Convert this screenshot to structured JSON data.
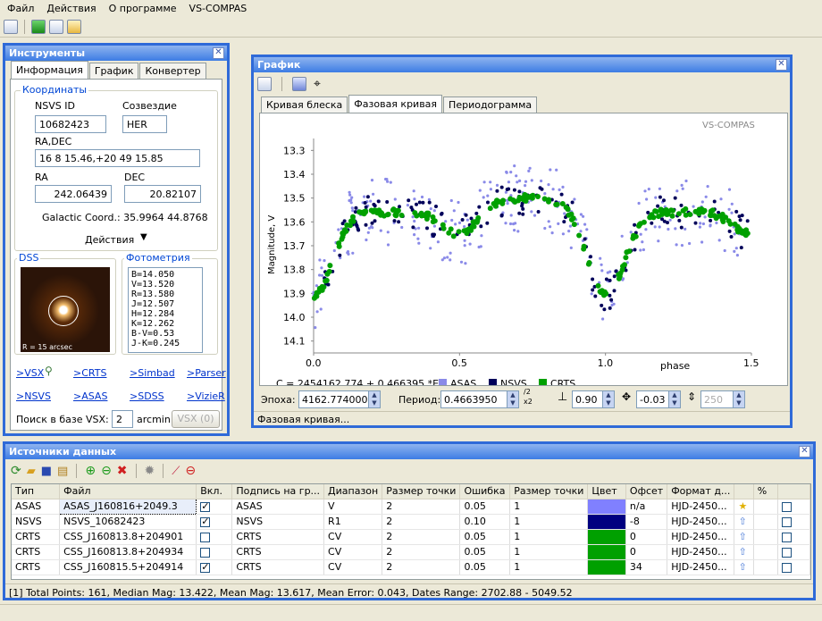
{
  "menu": [
    "Файл",
    "Действия",
    "О программе",
    "VS-COMPAS"
  ],
  "tools": {
    "title": "Инструменты",
    "tabs": [
      "Информация",
      "График",
      "Конвертер"
    ],
    "coords": {
      "group_label": "Координаты",
      "nsvs_label": "NSVS ID",
      "nsvs_value": "10682423",
      "const_label": "Созвездие",
      "const_value": "HER",
      "radec_label": "RA,DEC",
      "radec_value": "16 8 15.46,+20 49 15.85",
      "ra_label": "RA",
      "ra_value": "242.06439",
      "dec_label": "DEC",
      "dec_value": "20.82107",
      "galactic": "Galactic Coord.: 35.9964 44.8768",
      "actions": "Действия"
    },
    "dss": {
      "label": "DSS",
      "radius": "R = 15 arcsec"
    },
    "photometry": {
      "label": "Фотометрия",
      "lines": [
        "B=14.050",
        "V=13.520",
        "R=13.580",
        "J=12.507",
        "H=12.284",
        "K=12.262",
        "B-V=0.53",
        "J-K=0.245"
      ]
    },
    "links": [
      ">VSX",
      ">CRTS",
      ">Simbad",
      ">Parser",
      ">NSVS",
      ">ASAS",
      ">SDSS",
      ">VizieR"
    ],
    "search_label": "Поиск в базе VSX:",
    "search_value": "2",
    "search_unit": "arcmin",
    "vsx_button": "VSX (0)"
  },
  "graph": {
    "title": "График",
    "tabs": [
      "Кривая блеска",
      "Фазовая кривая",
      "Периодограмма"
    ],
    "watermark": "VS-COMPAS",
    "epoch_label": "Эпоха:",
    "epoch_value": "4162.774000",
    "period_label": "Период:",
    "period_value": "0.4663950",
    "period_mult": "/2",
    "period_mult2": "x2",
    "spin1": "0.90",
    "spin2": "-0.03",
    "spin3": "250",
    "status": "Фазовая кривая..."
  },
  "chart_data": {
    "type": "scatter",
    "xlabel": "phase",
    "ylabel": "Magnitude, V",
    "xlim": [
      0,
      1.5
    ],
    "ylim": [
      14.15,
      13.25
    ],
    "xticks": [
      "0.0",
      "0.5",
      "1.0",
      "1.5"
    ],
    "yticks": [
      "13.3",
      "13.4",
      "13.5",
      "13.6",
      "13.7",
      "13.8",
      "13.9",
      "14.0",
      "14.1"
    ],
    "formula": "C = 2454162.774 + 0.466395 *E",
    "legend": [
      {
        "name": "ASAS",
        "color": "#8a8ae8"
      },
      {
        "name": "NSVS",
        "color": "#00005a"
      },
      {
        "name": "CRTS",
        "color": "#00a000"
      }
    ],
    "series": [
      {
        "name": "ASAS",
        "color": "#8a8ae8"
      },
      {
        "name": "NSVS",
        "color": "#00005a"
      },
      {
        "name": "CRTS",
        "color": "#00a000"
      }
    ]
  },
  "sources": {
    "title": "Источники данных",
    "columns": [
      "Тип",
      "Файл",
      "Вкл.",
      "Подпись на гр...",
      "Диапазон",
      "Размер точки",
      "Ошибка",
      "Размер точки",
      "Цвет",
      "Офсет",
      "Формат д...",
      "",
      "%",
      ""
    ],
    "rows": [
      {
        "type": "ASAS",
        "file": "ASAS_J160816+2049.3",
        "on": true,
        "label": "ASAS",
        "band": "V",
        "size": "2",
        "err": "0.05",
        "size2": "1",
        "color": "#8080ff",
        "offset": "n/a",
        "format": "HJD-2450...",
        "icon": "star-icon"
      },
      {
        "type": "NSVS",
        "file": "NSVS_10682423",
        "on": true,
        "label": "NSVS",
        "band": "R1",
        "size": "2",
        "err": "0.10",
        "size2": "1",
        "color": "#000080",
        "offset": "-8",
        "format": "HJD-2450...",
        "icon": "arrow-up-icon"
      },
      {
        "type": "CRTS",
        "file": "CSS_J160813.8+204901",
        "on": false,
        "label": "CRTS",
        "band": "CV",
        "size": "2",
        "err": "0.05",
        "size2": "1",
        "color": "#00a000",
        "offset": "0",
        "format": "HJD-2450...",
        "icon": "arrow-up-icon"
      },
      {
        "type": "CRTS",
        "file": "CSS_J160813.8+204934",
        "on": false,
        "label": "CRTS",
        "band": "CV",
        "size": "2",
        "err": "0.05",
        "size2": "1",
        "color": "#00a000",
        "offset": "0",
        "format": "HJD-2450...",
        "icon": "arrow-up-icon"
      },
      {
        "type": "CRTS",
        "file": "CSS_J160815.5+204914",
        "on": true,
        "label": "CRTS",
        "band": "CV",
        "size": "2",
        "err": "0.05",
        "size2": "1",
        "color": "#00a000",
        "offset": "34",
        "format": "HJD-2450...",
        "icon": "arrow-up-icon"
      }
    ],
    "summary": "[1] Total Points: 161, Median Mag: 13.422, Mean Mag: 13.617, Mean Error: 0.043, Dates Range: 2702.88 - 5049.52"
  }
}
